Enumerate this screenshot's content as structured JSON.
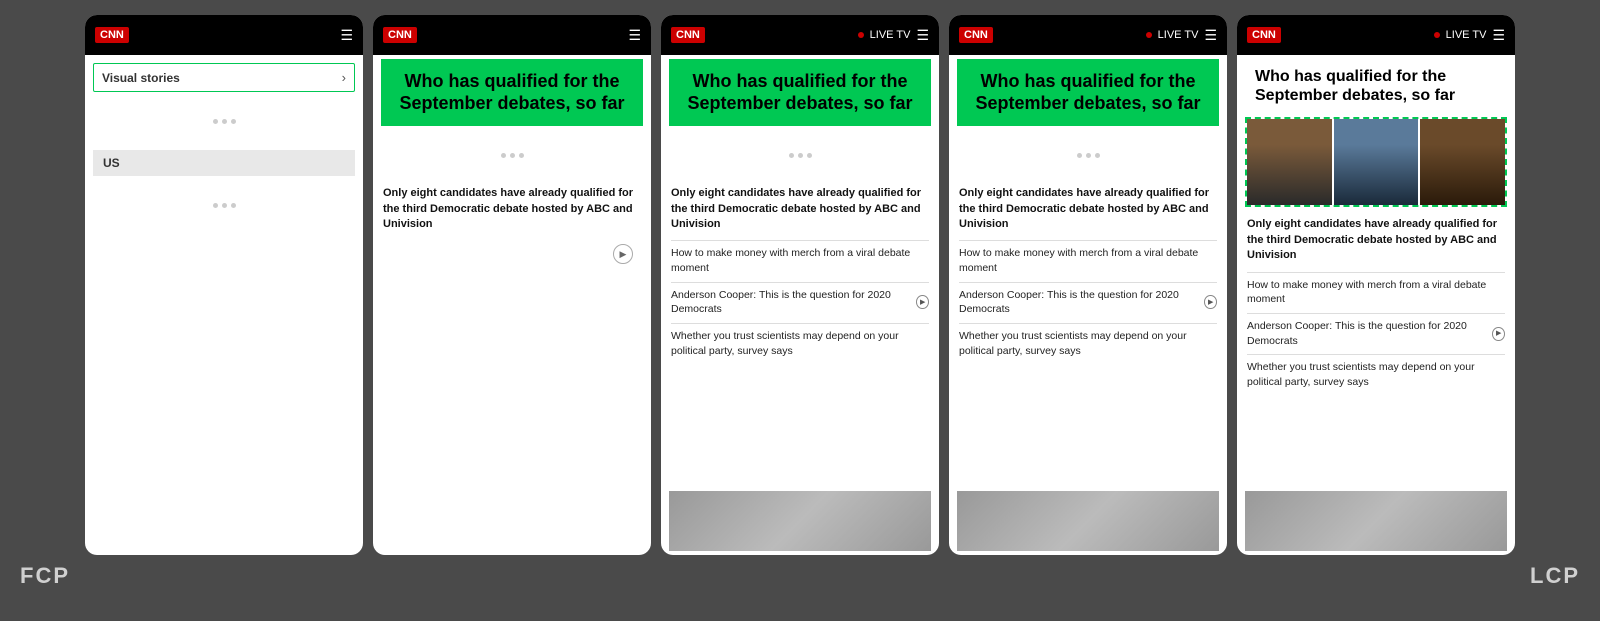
{
  "background_color": "#4a4a4a",
  "labels": {
    "fcp": "FCP",
    "lcp": "LCP"
  },
  "phones": [
    {
      "id": "phone-1",
      "has_live_tv": false,
      "visual_stories": {
        "label": "Visual stories",
        "chevron": "›"
      },
      "us_label": "US",
      "content": "blank"
    },
    {
      "id": "phone-2",
      "has_live_tv": false,
      "headline": "Who has qualified for the September debates, so far",
      "lead_text": "Only eight candidates have already qualified for the third Democratic debate hosted by ABC and Univision",
      "content": "article-only"
    },
    {
      "id": "phone-3",
      "has_live_tv": true,
      "headline": "Who has qualified for the September debates, so far",
      "lead_text": "Only eight candidates have already qualified for the third Democratic debate hosted by ABC and Univision",
      "sub_items": [
        "How to make money with merch from a viral debate moment",
        "Anderson Cooper: This is the question for 2020 Democrats",
        "Whether you trust scientists may depend on your political party, survey says"
      ],
      "content": "article-video"
    },
    {
      "id": "phone-4",
      "has_live_tv": true,
      "headline": "Who has qualified for the September debates, so far",
      "lead_text": "Only eight candidates have already qualified for the third Democratic debate hosted by ABC and Univision",
      "sub_items": [
        "How to make money with merch from a viral debate moment",
        "Anderson Cooper: This is the question for 2020 Democrats",
        "Whether you trust scientists may depend on your political party, survey says"
      ],
      "content": "article-video"
    },
    {
      "id": "phone-5",
      "has_live_tv": true,
      "headline": "Who has qualified for the September debates, so far",
      "lead_text": "Only eight candidates have already qualified for the third Democratic debate hosted by ABC and Univision",
      "sub_items": [
        "How to make money with merch from a viral debate moment",
        "Anderson Cooper: This is the question for 2020 Democrats",
        "Whether you trust scientists may depend on your political party, survey says"
      ],
      "content": "article-image-video"
    }
  ],
  "cnn_logo": "CNN",
  "live_tv_label": "LIVE TV",
  "menu_icon": "☰"
}
